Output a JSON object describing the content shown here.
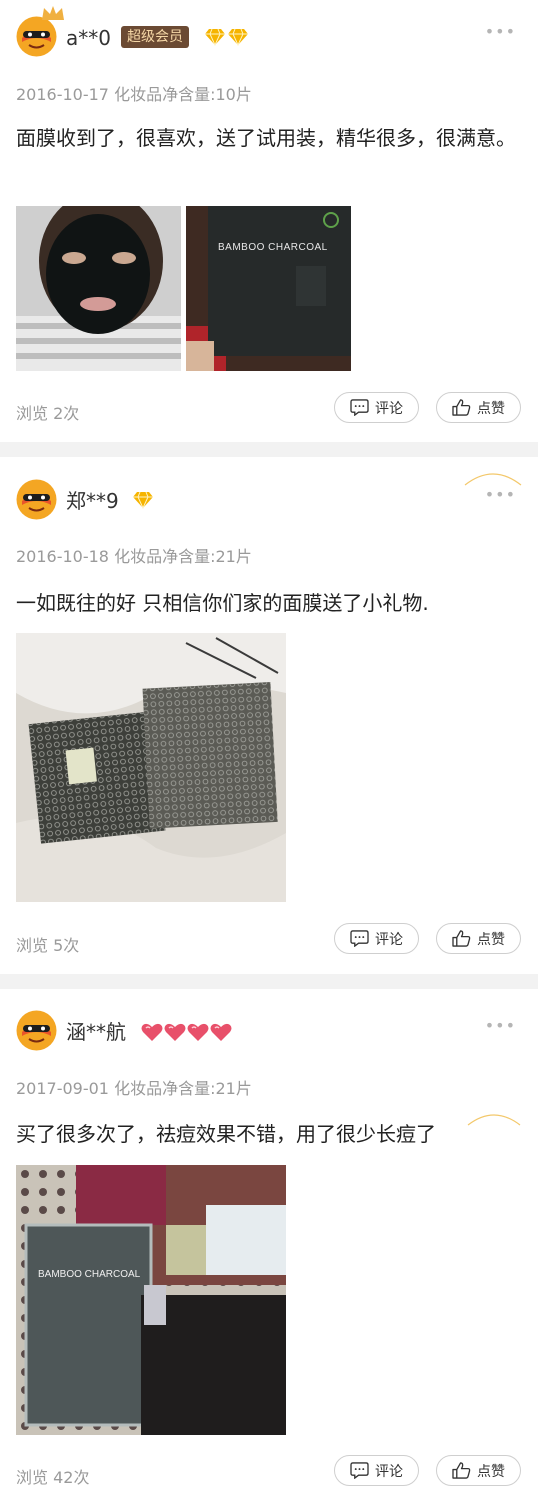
{
  "reviews": [
    {
      "username": "a**0",
      "vip_label": "超级会员",
      "badge": "diamond-icon",
      "badge_count": 2,
      "meta": "2016-10-17 化妆品净含量:10片",
      "content": "面膜收到了，很喜欢，送了试用装，精华很多，很满意。",
      "views": "浏览 2次",
      "comment_label": "评论",
      "like_label": "点赞",
      "photos": [
        {
          "name": "photo-face-mask"
        },
        {
          "name": "photo-bamboo-charcoal-box",
          "caption": "BAMBOO CHARCOAL"
        }
      ]
    },
    {
      "username": "郑**9",
      "badge": "diamond-icon",
      "badge_count": 1,
      "meta": "2016-10-18 化妆品净含量:21片",
      "content": "一如既往的好 只相信你们家的面膜送了小礼物.",
      "views": "浏览 5次",
      "comment_label": "评论",
      "like_label": "点赞",
      "photos": [
        {
          "name": "photo-bubble-wrap-packages"
        }
      ]
    },
    {
      "username": "涵**航",
      "badge": "heart-icon",
      "badge_count": 4,
      "meta": "2017-09-01 化妆品净含量:21片",
      "content": "买了很多次了，祛痘效果不错，用了很少长痘了",
      "views": "浏览 42次",
      "comment_label": "评论",
      "like_label": "点赞",
      "photos": [
        {
          "name": "photo-products-with-gifts",
          "caption": "BAMBOO CHARCOAL"
        }
      ]
    }
  ],
  "more_icon": "more-dots-icon",
  "colors": {
    "vip_bg": "#6b4a33",
    "vip_text": "#f5d7a6",
    "diamond": "#f6b400",
    "heart": "#e8506a",
    "muted": "#9a9a9a",
    "page_bg": "#f2f2f2"
  }
}
